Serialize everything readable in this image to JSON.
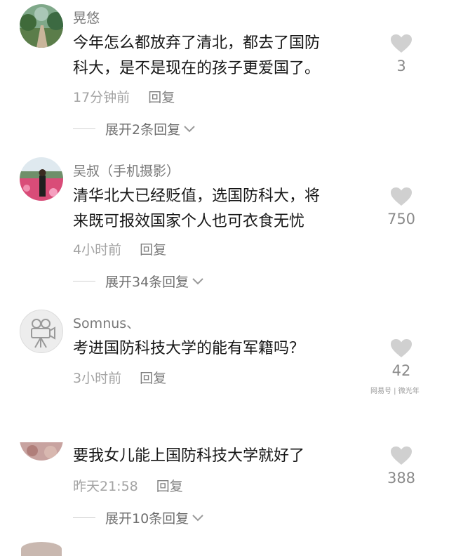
{
  "comments": [
    {
      "username": "晃悠",
      "lines": [
        "今年怎么都放弃了清北，都去了国防",
        "科大，是不是现在的孩子更爱国了。"
      ],
      "time": "17分钟前",
      "reply": "回复",
      "likes": "3",
      "expand": "展开2条回复"
    },
    {
      "username": "吴叔（手机摄影）",
      "lines": [
        "清华北大已经贬值，选国防科大，将",
        "来既可报效国家个人也可衣食无忧"
      ],
      "time": "4小时前",
      "reply": "回复",
      "likes": "750",
      "expand": "展开34条回复"
    },
    {
      "username": "Somnus、",
      "lines": [
        "考进国防科技大学的能有军籍吗？"
      ],
      "time": "3小时前",
      "reply": "回复",
      "likes": "42"
    },
    {
      "lines": [
        "要我女儿能上国防科技大学就好了"
      ],
      "time": "昨天21:58",
      "reply": "回复",
      "likes": "388",
      "expand": "展开10条回复"
    }
  ],
  "watermark": "网易号 | 微光年",
  "icons": {
    "heart": "heart-icon",
    "chevron": "chevron-down-icon",
    "camera": "movie-camera-icon"
  },
  "colors": {
    "heart": "#d0d0d0",
    "text": "#161616",
    "meta": "#a3a3a3"
  }
}
